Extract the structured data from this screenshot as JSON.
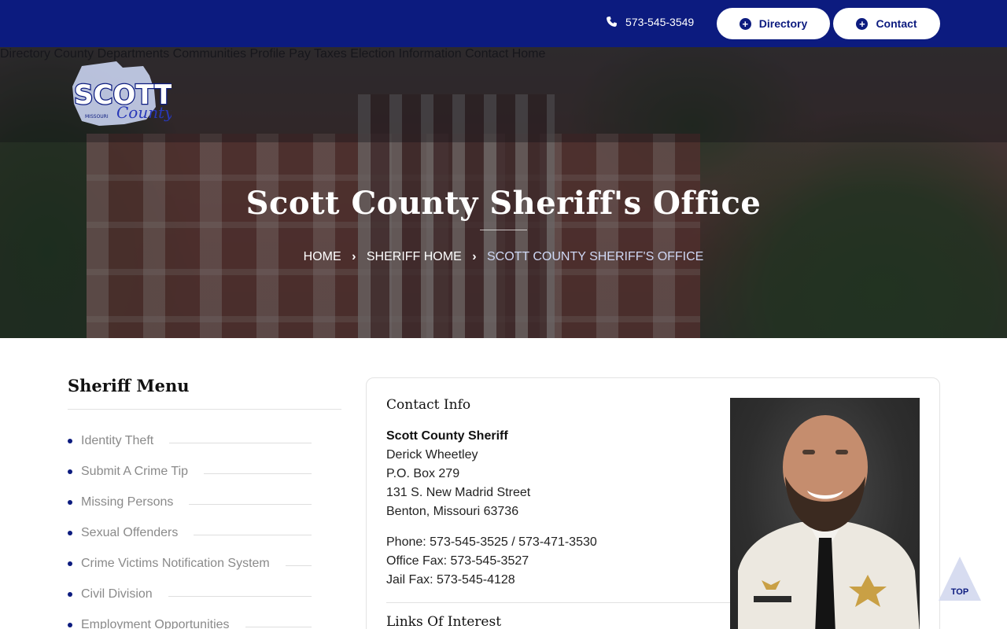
{
  "topbar": {
    "phone": "573-545-3549",
    "directory_label": "Directory",
    "contact_label": "Contact"
  },
  "logo": {
    "text": "SCOTT",
    "script": "County",
    "state": "MISSOURI"
  },
  "nav": {
    "items": [
      "Directory",
      "County Departments",
      "Communities",
      "Profile",
      "Pay Taxes",
      "Election Information",
      "Contact",
      "Home"
    ]
  },
  "hero": {
    "title": "Scott County Sheriff's Office",
    "breadcrumb": [
      "HOME",
      "SHERIFF HOME",
      "SCOTT COUNTY SHERIFF'S OFFICE"
    ]
  },
  "sidebar": {
    "title": "Sheriff Menu",
    "items": [
      "Identity Theft",
      "Submit A Crime Tip",
      "Missing Persons",
      "Sexual Offenders",
      "Crime Victims Notification System",
      "Civil Division",
      "Employment Opportunities"
    ]
  },
  "contact": {
    "heading": "Contact Info",
    "org": "Scott County Sheriff",
    "name": "Derick Wheetley",
    "po_box": "P.O. Box 279",
    "street": "131 S. New Madrid Street",
    "city": "Benton, Missouri 63736",
    "phone": "Phone: 573-545-3525 / 573-471-3530",
    "office_fax": "Office Fax: 573-545-3527",
    "jail_fax": "Jail Fax: 573-545-4128",
    "links_heading": "Links Of Interest"
  },
  "top_button": "TOP",
  "colors": {
    "brand_navy": "#0c1b7f",
    "menu_dot": "#0c1b7f",
    "breadcrumb_current": "#cfd8f5"
  }
}
